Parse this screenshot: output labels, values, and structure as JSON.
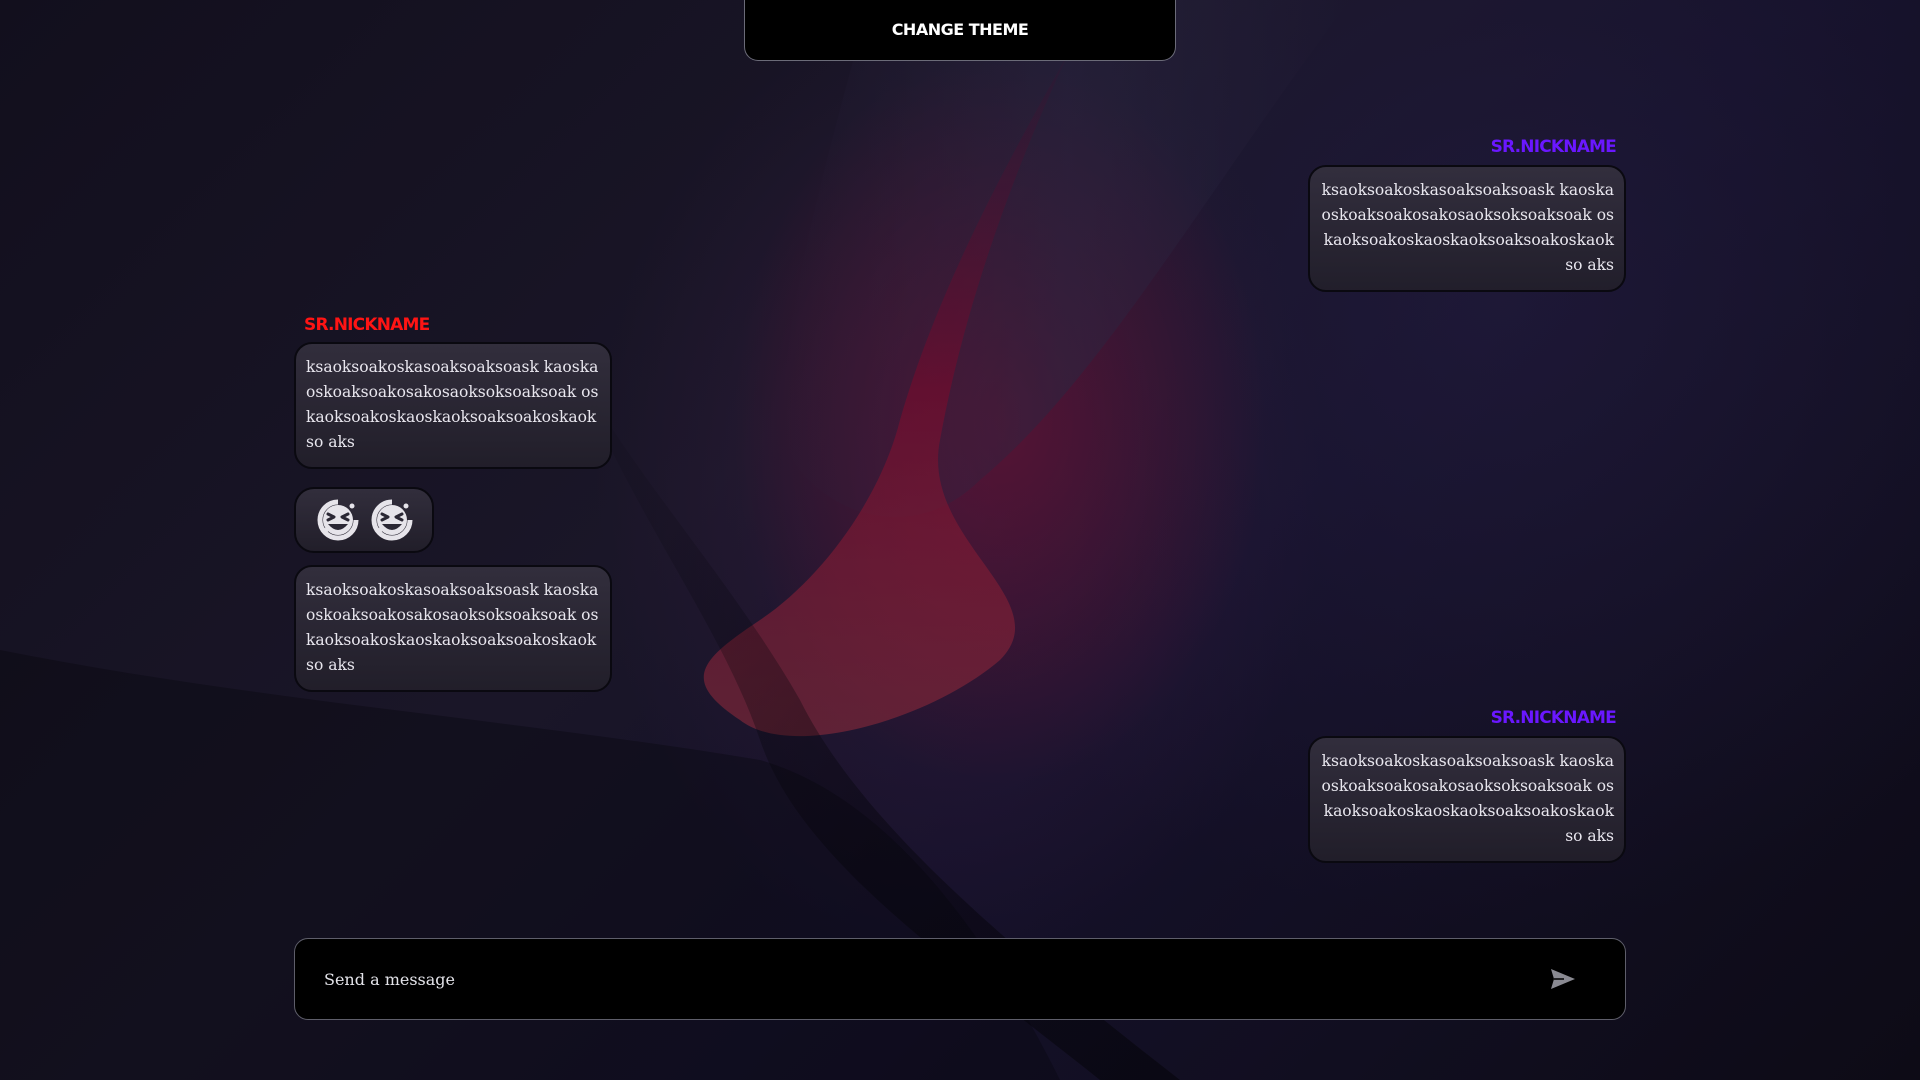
{
  "header": {
    "theme_button_label": "CHANGE THEME"
  },
  "messages": [
    {
      "side": "right",
      "nickname": "SR.NICKNAME",
      "nickname_color": "#6a17ff",
      "text": "ksaoksoakoskasoaksoaksoask kaoskaoskoaksoakosakosaoksoksoaksoak oskaoksoakoskaoskaoksoaksoakoskaokso aks"
    },
    {
      "side": "left",
      "nickname": "SR.NICKNAME",
      "nickname_color": "#ff1414",
      "text": "ksaoksoakoskasoaksoaksoask kaoskaoskoaksoakosakosaoksoksoaksoak oskaoksoakoskaoskaoksoaksoakoskaokso aks"
    },
    {
      "side": "left",
      "type": "emoji",
      "emojis": [
        "laughing-face-icon",
        "laughing-face-icon"
      ]
    },
    {
      "side": "left",
      "text": "ksaoksoakoskasoaksoaksoask kaoskaoskoaksoakosakosaoksoksoaksoak oskaoksoakoskaoskaoksoaksoakoskaokso aks"
    },
    {
      "side": "right",
      "nickname": "SR.NICKNAME",
      "nickname_color": "#6a17ff",
      "text": "ksaoksoakoskasoaksoaksoask kaoskaoskoaksoakosakosaoksoksoaksoak oskaoksoakoskaoskaoksoaksoakoskaokso aks"
    }
  ],
  "composer": {
    "placeholder": "Send a message",
    "value": "",
    "send_icon": "send-icon"
  },
  "colors": {
    "accent_red": "#ff1414",
    "accent_purple": "#6a17ff",
    "background": "#0f0c1a"
  }
}
